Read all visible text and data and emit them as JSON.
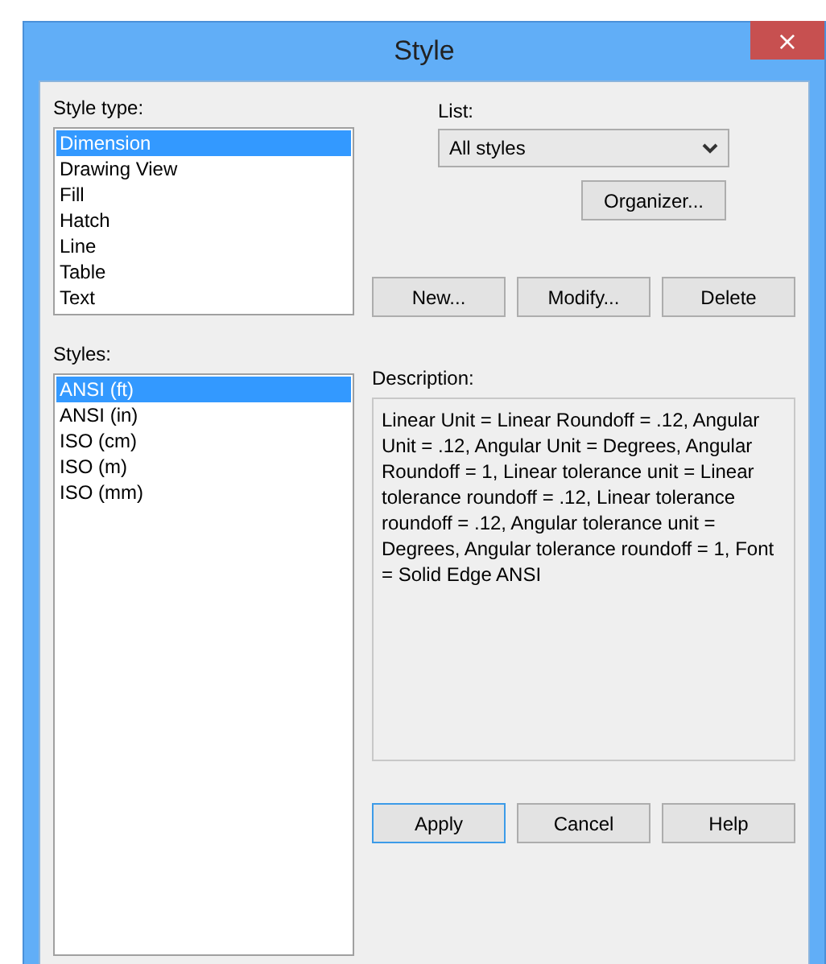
{
  "window": {
    "title": "Style",
    "close": "×"
  },
  "style_type": {
    "label": "Style type:",
    "items": [
      {
        "label": "Dimension",
        "selected": true
      },
      {
        "label": "Drawing View",
        "selected": false
      },
      {
        "label": "Fill",
        "selected": false
      },
      {
        "label": "Hatch",
        "selected": false
      },
      {
        "label": "Line",
        "selected": false
      },
      {
        "label": "Table",
        "selected": false
      },
      {
        "label": "Text",
        "selected": false
      }
    ]
  },
  "list": {
    "label": "List:",
    "value": "All styles"
  },
  "organizer_button": "Organizer...",
  "styles": {
    "label": "Styles:",
    "items": [
      {
        "label": "ANSI (ft)",
        "selected": true
      },
      {
        "label": "ANSI (in)",
        "selected": false
      },
      {
        "label": "ISO (cm)",
        "selected": false
      },
      {
        "label": "ISO (m)",
        "selected": false
      },
      {
        "label": "ISO (mm)",
        "selected": false
      }
    ]
  },
  "style_buttons": [
    "New...",
    "Modify...",
    "Delete"
  ],
  "description": {
    "label": "Description:",
    "text": "Linear Unit = Linear Roundoff = .12, Angular Unit = .12, Angular Unit = Degrees, Angular Roundoff = 1, Linear tolerance unit = Linear tolerance roundoff = .12, Linear tolerance roundoff = .12, Angular tolerance unit = Degrees, Angular tolerance roundoff = 1, Font = Solid Edge ANSI"
  },
  "buttons": [
    {
      "label": "Apply",
      "default": true
    },
    {
      "label": "Cancel",
      "default": false
    },
    {
      "label": "Help",
      "default": false
    }
  ]
}
